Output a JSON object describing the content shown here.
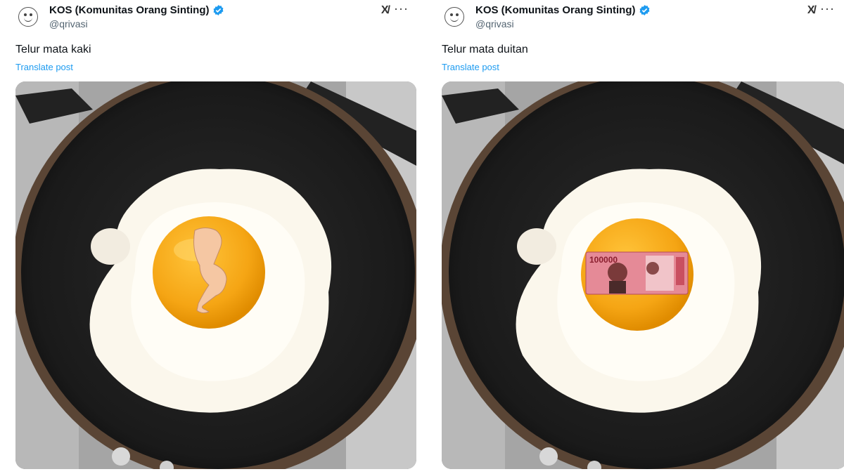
{
  "posts": [
    {
      "author": {
        "display_name": "KOS (Komunitas Orang Sinting)",
        "handle": "@qrivasi",
        "verified": true
      },
      "text": "Telur mata kaki",
      "translate_label": "Translate post",
      "media": {
        "icon": "leg-icon"
      }
    },
    {
      "author": {
        "display_name": "KOS (Komunitas Orang Sinting)",
        "handle": "@qrivasi",
        "verified": true
      },
      "text": "Telur mata duitan",
      "translate_label": "Translate post",
      "media": {
        "icon": "banknote-icon",
        "banknote_value": "100000"
      }
    }
  ],
  "icons": {
    "grok": "grok-icon",
    "more": "more-options-icon",
    "verified": "verified-badge-icon"
  },
  "colors": {
    "link": "#1d9bf0",
    "verified": "#1d9bf0",
    "yolk": "#f5a514",
    "pan": "#1f1f1f"
  }
}
